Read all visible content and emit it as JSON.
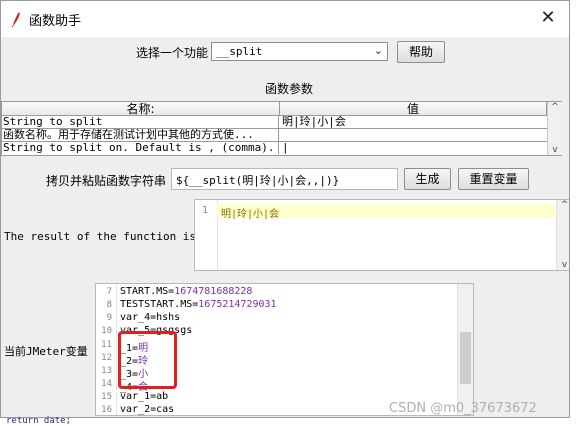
{
  "window": {
    "title": "函数助手",
    "close_symbol": "✕"
  },
  "function_select": {
    "label": "选择一个功能",
    "selected": "__split",
    "help_button": "帮助"
  },
  "params": {
    "heading": "函数参数",
    "col_name": "名称:",
    "col_value": "值",
    "rows": [
      {
        "name": "String to split",
        "value": "明|玲|小|会"
      },
      {
        "name": "函数名称。用于存储在测试计划中其他的方式使...",
        "value": ""
      },
      {
        "name": "String to split on. Default is , (comma).",
        "value": "|"
      }
    ]
  },
  "copy": {
    "label": "拷贝并粘贴函数字符串",
    "value": "${__split(明|玲|小|会,,|)}",
    "generate_button": "生成",
    "reset_button": "重置变量"
  },
  "result": {
    "label": "The result of the function is",
    "lines": [
      {
        "num": "1",
        "text": "明|玲|小|会"
      }
    ]
  },
  "vars": {
    "label": "当前JMeter变量",
    "lines": [
      {
        "num": "7",
        "key": "START.MS=",
        "val": "1674781688228"
      },
      {
        "num": "8",
        "key": "TESTSTART.MS=",
        "val": "1675214729031"
      },
      {
        "num": "9",
        "key": "var_4=hshs",
        "val": ""
      },
      {
        "num": "10",
        "key": "var_5=gsgsgs",
        "val": ""
      },
      {
        "num": "11",
        "key": "_1=",
        "val": "明"
      },
      {
        "num": "12",
        "key": "_2=",
        "val": "玲"
      },
      {
        "num": "13",
        "key": "_3=",
        "val": "小"
      },
      {
        "num": "14",
        "key": "_4=",
        "val": "会"
      },
      {
        "num": "15",
        "key": "var_1=ab",
        "val": ""
      },
      {
        "num": "16",
        "key": "var_2=cas",
        "val": ""
      }
    ]
  },
  "footer": {
    "code_snippet": "return date;",
    "watermark": "CSDN @m0_37673672"
  },
  "colors": {
    "highlight": "#ffffcc",
    "annotation_box": "#e02020",
    "value_purple": "#7a2cb0"
  }
}
